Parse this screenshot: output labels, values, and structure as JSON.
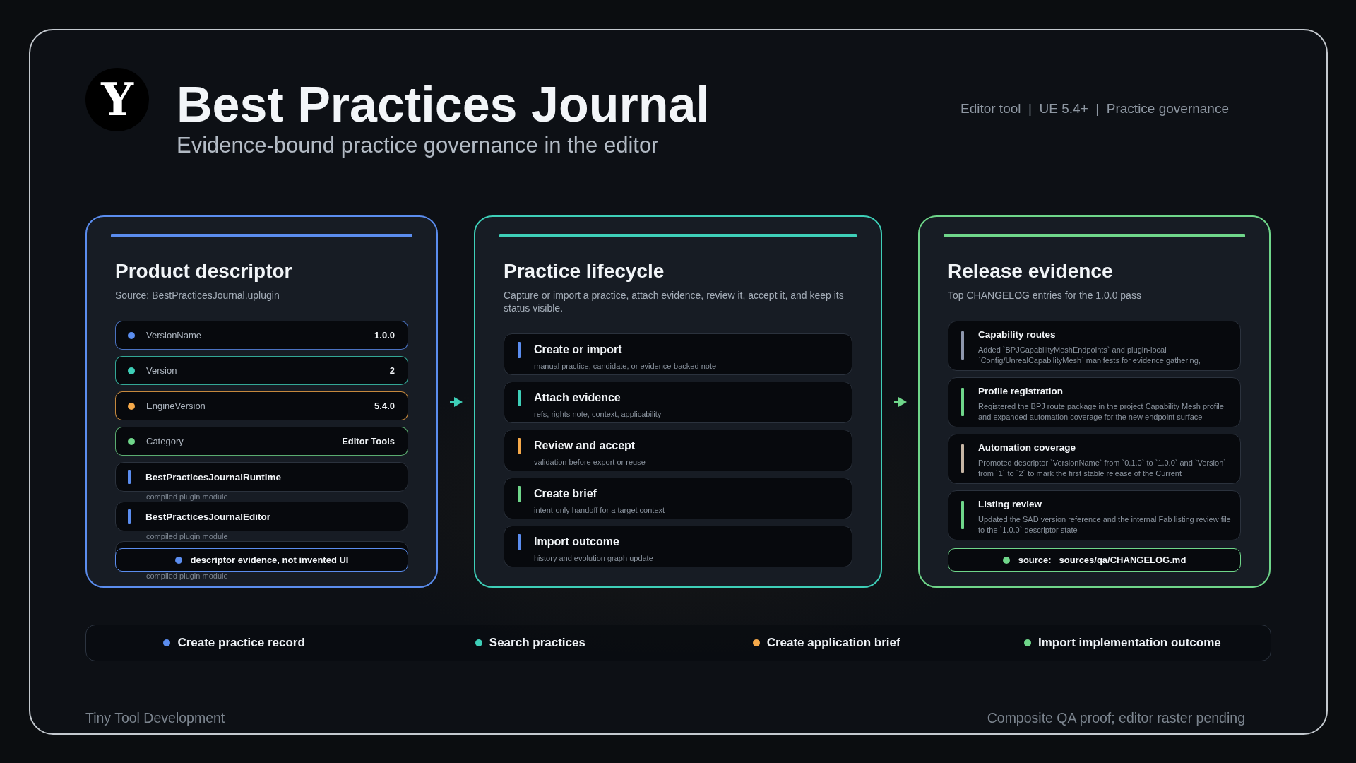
{
  "header": {
    "logo": "Y",
    "title": "Best Practices Journal",
    "subtitle": "Evidence-bound practice governance in the editor",
    "meta": "Editor tool  |  UE 5.4+  |  Practice governance"
  },
  "cards": [
    {
      "title": "Product descriptor",
      "subtitle": "Source: BestPracticesJournal.uplugin",
      "color": "#5b8def",
      "fields": [
        {
          "label": "VersionName",
          "value": "1.0.0",
          "color": "#5b8def"
        },
        {
          "label": "Version",
          "value": "2",
          "color": "#3ecfb8"
        },
        {
          "label": "EngineVersion",
          "value": "5.4.0",
          "color": "#f5a94a"
        },
        {
          "label": "Category",
          "value": "Editor Tools",
          "color": "#6fd68a"
        }
      ],
      "modules": [
        {
          "name": "BestPracticesJournalRuntime",
          "detail": "compiled plugin module"
        },
        {
          "name": "BestPracticesJournalEditor",
          "detail": "compiled plugin module"
        },
        {
          "detail": "compiled plugin module"
        }
      ],
      "badge": {
        "text": "descriptor evidence, not invented UI",
        "color": "#5b8def"
      }
    },
    {
      "title": "Practice lifecycle",
      "subtitle": "Capture or import a practice, attach evidence, review it, accept it, and keep its status visible.",
      "color": "#3ecfb8",
      "steps": [
        {
          "title": "Create or import",
          "detail": "manual practice, candidate, or evidence-backed note",
          "color": "#5b8def"
        },
        {
          "title": "Attach evidence",
          "detail": "refs, rights note, context, applicability",
          "color": "#3ecfb8"
        },
        {
          "title": "Review and accept",
          "detail": "validation before export or reuse",
          "color": "#f5a94a"
        },
        {
          "title": "Create brief",
          "detail": "intent-only handoff for a target context",
          "color": "#6fd68a"
        },
        {
          "title": "Import outcome",
          "detail": "history and evolution graph update",
          "color": "#5b8def"
        }
      ]
    },
    {
      "title": "Release evidence",
      "subtitle": "Top CHANGELOG entries for the 1.0.0 pass",
      "color": "#6fd68a",
      "entries": [
        {
          "title": "Capability routes",
          "detail": "Added `BPJCapabilityMeshEndpoints` and plugin-local `Config/UnrealCapabilityMesh` manifests for evidence gathering,",
          "color": "#8e97ad"
        },
        {
          "title": "Profile registration",
          "detail": "Registered the BPJ route package in the project Capability Mesh profile and expanded automation coverage for the new endpoint surface",
          "color": "#6fd68a"
        },
        {
          "title": "Automation coverage",
          "detail": "Promoted descriptor `VersionName` from `0.1.0` to `1.0.0` and `Version` from `1` to `2` to mark the first stable release of the Current",
          "color": "#c7b6a5"
        },
        {
          "title": "Listing review",
          "detail": "Updated the SAD version reference and the internal Fab listing review file to the `1.0.0` descriptor state",
          "color": "#6fd68a"
        }
      ],
      "badge": {
        "text": "source: _sources/qa/CHANGELOG.md",
        "color": "#6fd68a"
      }
    }
  ],
  "actions": [
    {
      "label": "Create practice record",
      "color": "#5b8def"
    },
    {
      "label": "Search practices",
      "color": "#3ecfb8"
    },
    {
      "label": "Create application brief",
      "color": "#f5a94a"
    },
    {
      "label": "Import implementation outcome",
      "color": "#6fd68a"
    }
  ],
  "footer": {
    "left": "Tiny Tool Development",
    "right": "Composite QA proof; editor raster pending"
  }
}
